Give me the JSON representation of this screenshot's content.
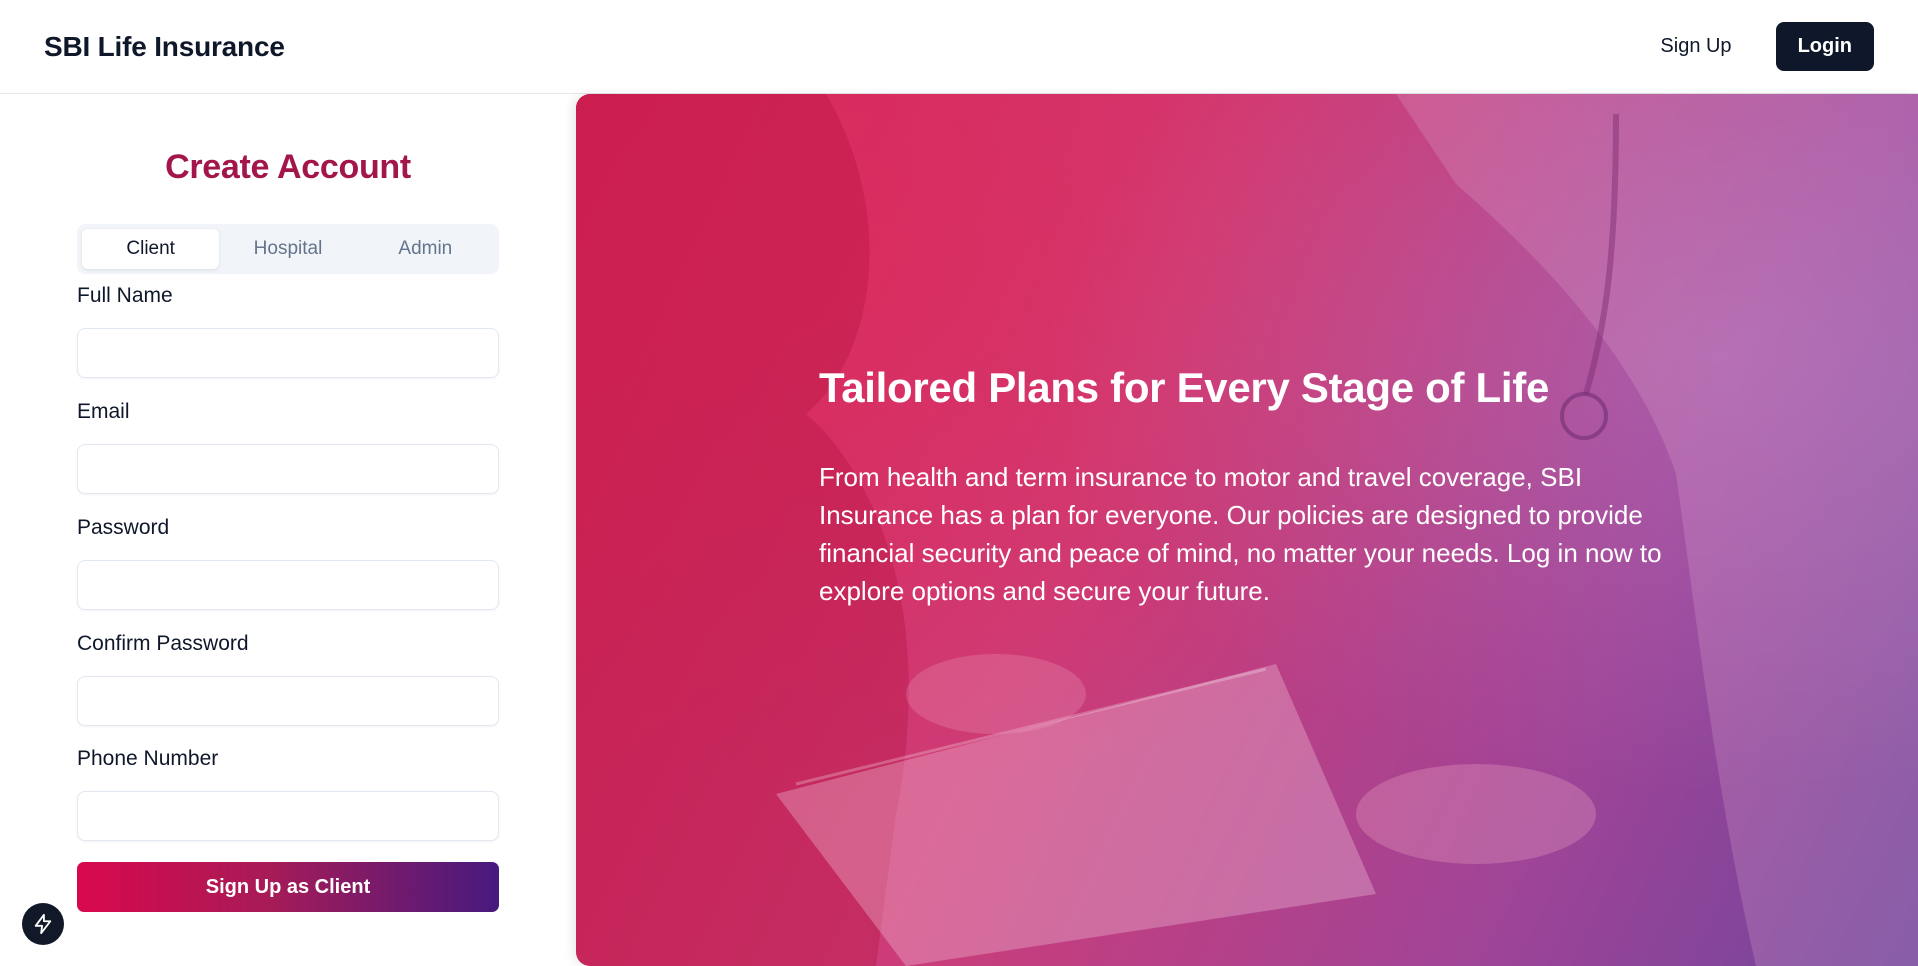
{
  "header": {
    "brand": "SBI Life Insurance",
    "signup_label": "Sign Up",
    "login_label": "Login"
  },
  "form": {
    "title": "Create Account",
    "tabs": [
      {
        "label": "Client",
        "active": true
      },
      {
        "label": "Hospital",
        "active": false
      },
      {
        "label": "Admin",
        "active": false
      }
    ],
    "fields": [
      {
        "label": "Full Name",
        "value": ""
      },
      {
        "label": "Email",
        "value": ""
      },
      {
        "label": "Password",
        "value": ""
      },
      {
        "label": "Confirm Password",
        "value": ""
      },
      {
        "label": "Phone Number",
        "value": ""
      }
    ],
    "submit_label": "Sign Up as Client"
  },
  "hero": {
    "title": "Tailored Plans for Every Stage of Life",
    "text": "From health and term insurance to motor and travel coverage, SBI Insurance has a plan for everyone. Our policies are designed to provide financial security and peace of mind, no matter your needs. Log in now to explore options and secure your future."
  },
  "colors": {
    "title_accent": "#a3164c",
    "button_gradient_start": "#d9084d",
    "button_gradient_end": "#461a7e",
    "login_button": "#0f172a"
  },
  "icons": {
    "floating_button": "lightning-bolt-icon"
  }
}
